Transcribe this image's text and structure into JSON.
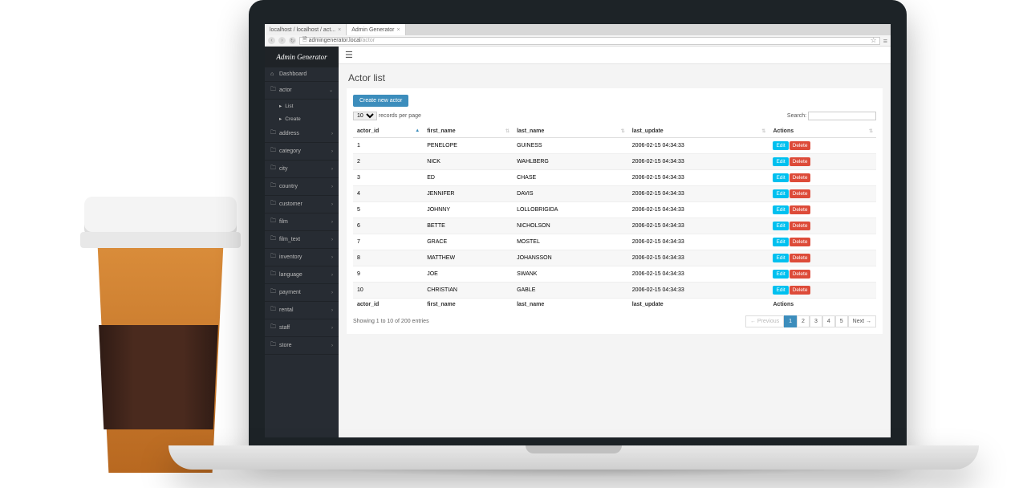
{
  "browser": {
    "tabs": [
      {
        "label": "localhost / localhost / act..."
      },
      {
        "label": "Admin Generator"
      }
    ],
    "url_host": "admingenerator.local",
    "url_path": "/actor"
  },
  "brand": "Admin Generator",
  "sidebar": {
    "dashboard": "Dashboard",
    "items": [
      {
        "label": "actor",
        "expanded": true
      },
      {
        "label": "address"
      },
      {
        "label": "category"
      },
      {
        "label": "city"
      },
      {
        "label": "country"
      },
      {
        "label": "customer"
      },
      {
        "label": "film"
      },
      {
        "label": "film_text"
      },
      {
        "label": "inventory"
      },
      {
        "label": "language"
      },
      {
        "label": "payment"
      },
      {
        "label": "rental"
      },
      {
        "label": "staff"
      },
      {
        "label": "store"
      }
    ],
    "sub": {
      "list": "List",
      "create": "Create"
    }
  },
  "page": {
    "title": "Actor list",
    "create_btn": "Create new actor",
    "perpage_value": "10",
    "perpage_suffix": "records per page",
    "search_label": "Search:",
    "columns": {
      "actor_id": "actor_id",
      "first_name": "first_name",
      "last_name": "last_name",
      "last_update": "last_update",
      "actions": "Actions"
    },
    "rows": [
      {
        "id": "1",
        "first": "PENELOPE",
        "last": "GUINESS",
        "updated": "2006-02-15 04:34:33"
      },
      {
        "id": "2",
        "first": "NICK",
        "last": "WAHLBERG",
        "updated": "2006-02-15 04:34:33"
      },
      {
        "id": "3",
        "first": "ED",
        "last": "CHASE",
        "updated": "2006-02-15 04:34:33"
      },
      {
        "id": "4",
        "first": "JENNIFER",
        "last": "DAVIS",
        "updated": "2006-02-15 04:34:33"
      },
      {
        "id": "5",
        "first": "JOHNNY",
        "last": "LOLLOBRIGIDA",
        "updated": "2006-02-15 04:34:33"
      },
      {
        "id": "6",
        "first": "BETTE",
        "last": "NICHOLSON",
        "updated": "2006-02-15 04:34:33"
      },
      {
        "id": "7",
        "first": "GRACE",
        "last": "MOSTEL",
        "updated": "2006-02-15 04:34:33"
      },
      {
        "id": "8",
        "first": "MATTHEW",
        "last": "JOHANSSON",
        "updated": "2006-02-15 04:34:33"
      },
      {
        "id": "9",
        "first": "JOE",
        "last": "SWANK",
        "updated": "2006-02-15 04:34:33"
      },
      {
        "id": "10",
        "first": "CHRISTIAN",
        "last": "GABLE",
        "updated": "2006-02-15 04:34:33"
      }
    ],
    "edit_label": "Edit",
    "delete_label": "Delete",
    "info": "Showing 1 to 10 of 200 entries",
    "pagination": {
      "prev": "← Previous",
      "next": "Next →",
      "pages": [
        "1",
        "2",
        "3",
        "4",
        "5"
      ]
    }
  }
}
